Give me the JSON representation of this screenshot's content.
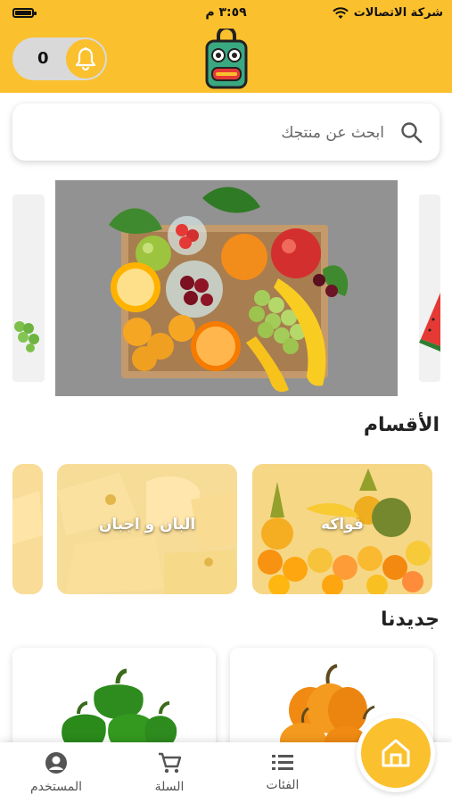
{
  "status_bar": {
    "carrier": "شركة الاتصالات",
    "time": "٣:٥٩ م"
  },
  "header": {
    "notification_count": "0"
  },
  "search": {
    "placeholder": "ابحث عن منتجك"
  },
  "sections": {
    "categories_title": "الأقسام",
    "new_title": "جديدنا"
  },
  "categories": [
    {
      "label": "فواكه"
    },
    {
      "label": "البان و اجبان"
    }
  ],
  "tabbar": {
    "categories_label": "الفئات",
    "cart_label": "السلة",
    "user_label": "المستخدم"
  },
  "colors": {
    "brand_yellow": "#fbc02d",
    "text_dark": "#222222",
    "tab_icon": "#555555"
  }
}
